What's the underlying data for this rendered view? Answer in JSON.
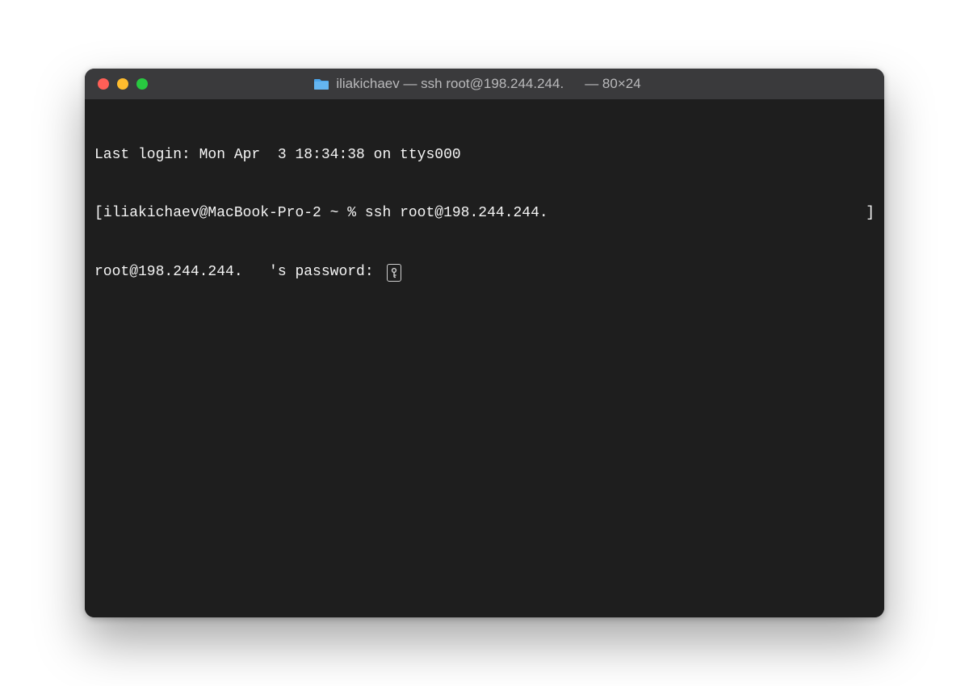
{
  "titlebar": {
    "title_main": "iliakichaev — ssh root@198.244.244.",
    "title_dims": "— 80×24"
  },
  "terminal": {
    "line1": "Last login: Mon Apr  3 18:34:38 on ttys000",
    "line2_open_bracket": "[",
    "line2_prompt": "iliakichaev@MacBook-Pro-2 ~ % ssh root@198.244.244.",
    "line2_close_bracket": "]",
    "line3_text": "root@198.244.244.   's password: "
  }
}
